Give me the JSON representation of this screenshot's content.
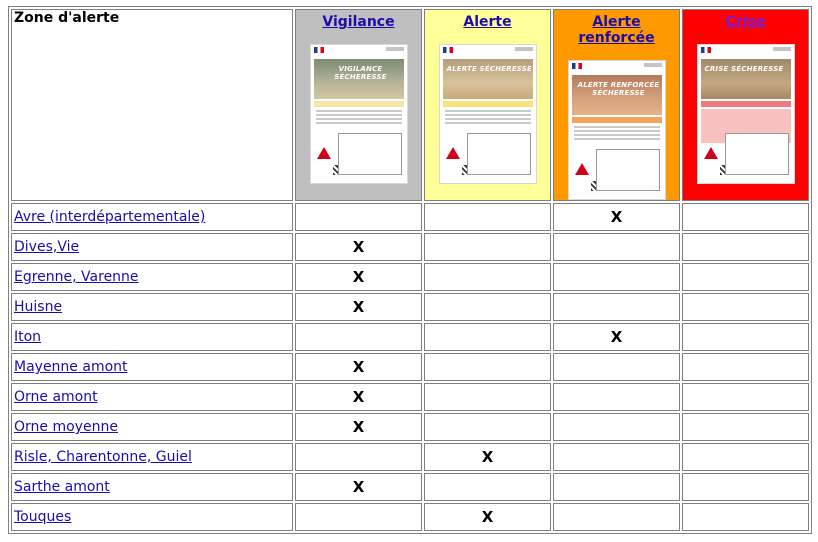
{
  "header": {
    "zone_label": "Zone d'alerte",
    "levels": [
      {
        "key": "v",
        "label": "Vigilance",
        "color": "#bfbfbf",
        "poster_title": "VIGILANCE SÉCHERESSE"
      },
      {
        "key": "a",
        "label": "Alerte",
        "color": "#ffff99",
        "poster_title": "ALERTE SÉCHERESSE"
      },
      {
        "key": "r",
        "label": "Alerte renforcée",
        "color": "#ff9900",
        "poster_title": "ALERTE RENFORCÉE SÉCHERESSE"
      },
      {
        "key": "c",
        "label": "Crise",
        "color": "#ff0000",
        "poster_title": "CRISE SÉCHERESSE"
      }
    ]
  },
  "rows": [
    {
      "zone": "Avre (interdépartementale)",
      "marks": [
        "",
        "",
        "X",
        ""
      ]
    },
    {
      "zone": "Dives,Vie",
      "marks": [
        "X",
        "",
        "",
        ""
      ]
    },
    {
      "zone": "Egrenne, Varenne",
      "marks": [
        "X",
        "",
        "",
        ""
      ]
    },
    {
      "zone": "Huisne",
      "marks": [
        "X",
        "",
        "",
        ""
      ]
    },
    {
      "zone": "Iton",
      "marks": [
        "",
        "",
        "X",
        ""
      ]
    },
    {
      "zone": "Mayenne amont",
      "marks": [
        "X",
        "",
        "",
        ""
      ]
    },
    {
      "zone": "Orne amont",
      "marks": [
        "X",
        "",
        "",
        ""
      ]
    },
    {
      "zone": "Orne moyenne",
      "marks": [
        "X",
        "",
        "",
        ""
      ]
    },
    {
      "zone": "Risle, Charentonne, Guiel",
      "marks": [
        "",
        "X",
        "",
        ""
      ]
    },
    {
      "zone": "Sarthe amont",
      "marks": [
        "X",
        "",
        "",
        ""
      ]
    },
    {
      "zone": "Touques",
      "marks": [
        "",
        "X",
        "",
        ""
      ]
    }
  ]
}
